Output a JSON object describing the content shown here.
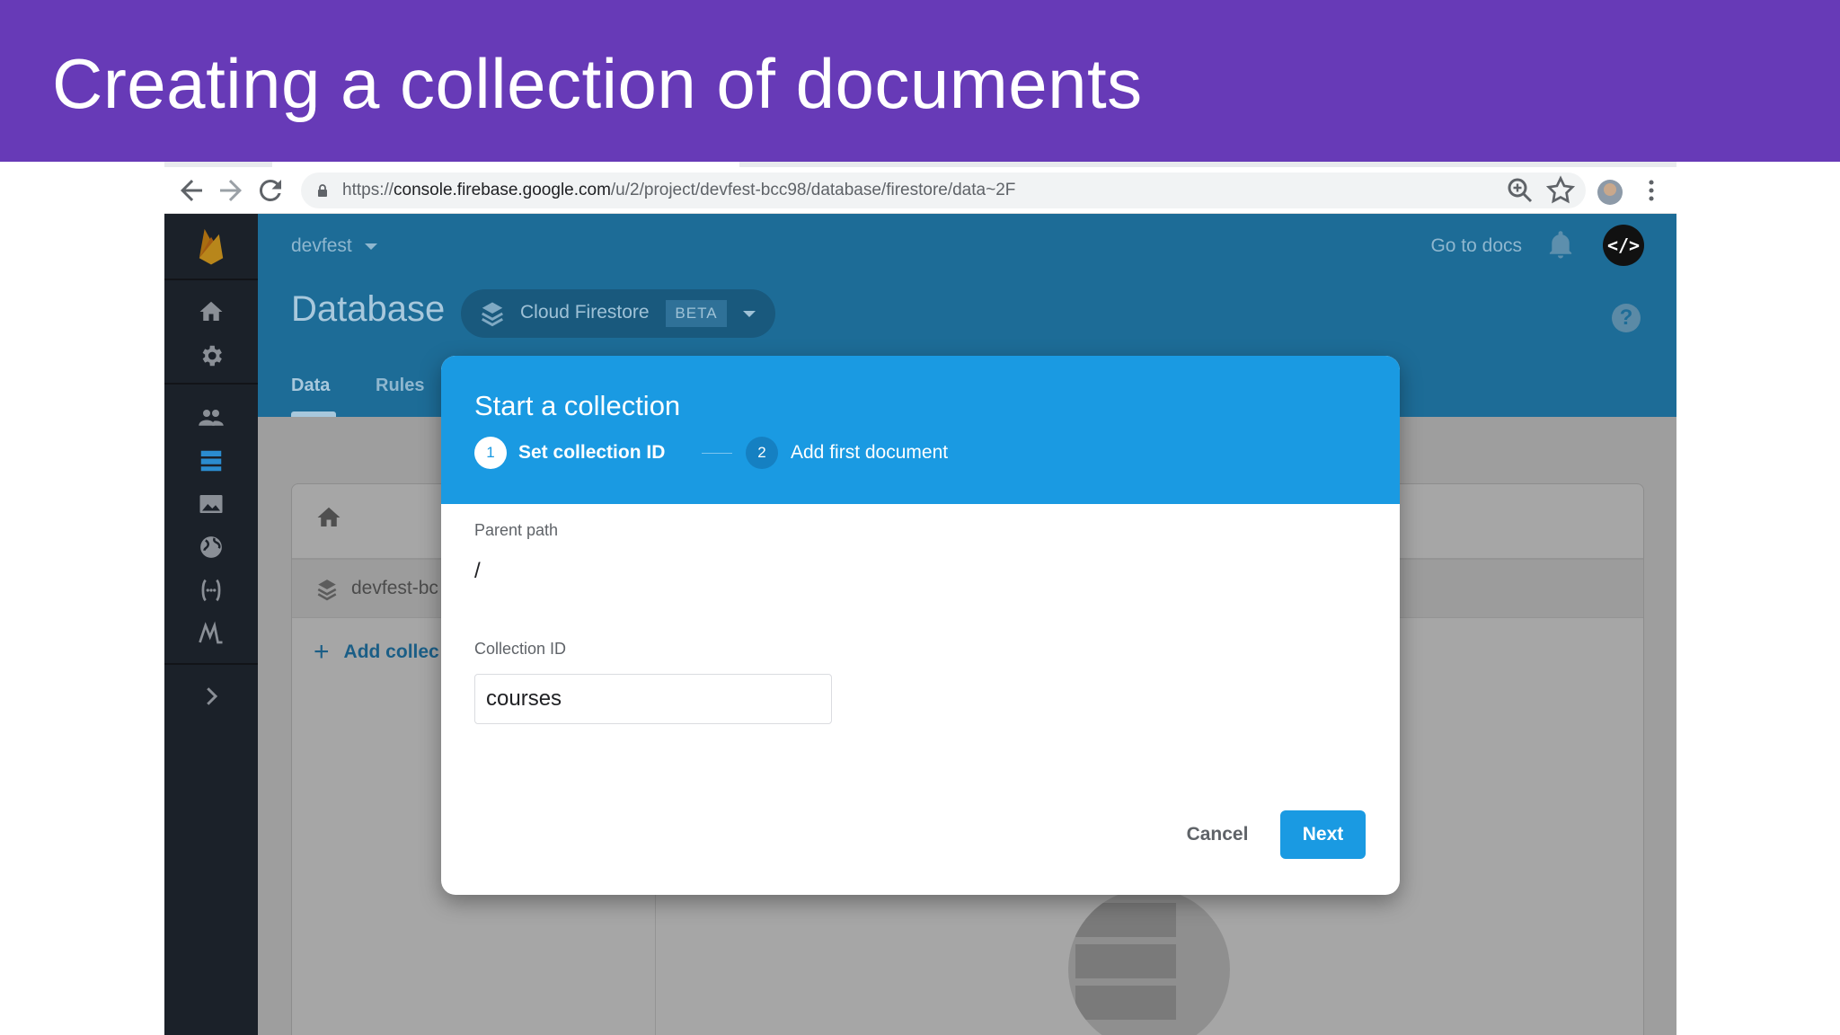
{
  "slide": {
    "title": "Creating a collection of documents"
  },
  "browser": {
    "url_scheme": "https://",
    "url_host": "console.firebase.google.com",
    "url_path": "/u/2/project/devfest-bcc98/database/firestore/data~2F"
  },
  "console": {
    "project_name": "devfest",
    "go_to_docs": "Go to docs",
    "code_button": "</>",
    "page_title": "Database",
    "db_selector_label": "Cloud Firestore",
    "db_selector_badge": "BETA",
    "help": "?",
    "tabs": [
      "Data",
      "Rules"
    ],
    "panel": {
      "db_name": "devfest-bc",
      "add_collection": "Add collec"
    }
  },
  "dialog": {
    "title": "Start a collection",
    "steps": [
      {
        "number": "1",
        "label": "Set collection ID",
        "active": true
      },
      {
        "number": "2",
        "label": "Add first document",
        "active": false
      }
    ],
    "parent_path_label": "Parent path",
    "parent_path_value": "/",
    "collection_id_label": "Collection ID",
    "collection_id_value": "courses",
    "cancel_label": "Cancel",
    "next_label": "Next"
  },
  "colors": {
    "slide_header": "#673AB7",
    "console_header": "#1D6C97",
    "sidenav": "#1b2129",
    "dialog_accent": "#1A9AE2"
  },
  "icons": [
    "back-arrow-icon",
    "forward-arrow-icon",
    "reload-icon",
    "lock-icon",
    "zoom-icon",
    "star-icon",
    "kebab-menu-icon",
    "firebase-logo",
    "home-icon",
    "gear-icon",
    "users-icon",
    "database-icon",
    "image-icon",
    "globe-icon",
    "functions-icon",
    "ml-icon",
    "chevron-right-icon",
    "bell-icon",
    "layers-icon"
  ]
}
